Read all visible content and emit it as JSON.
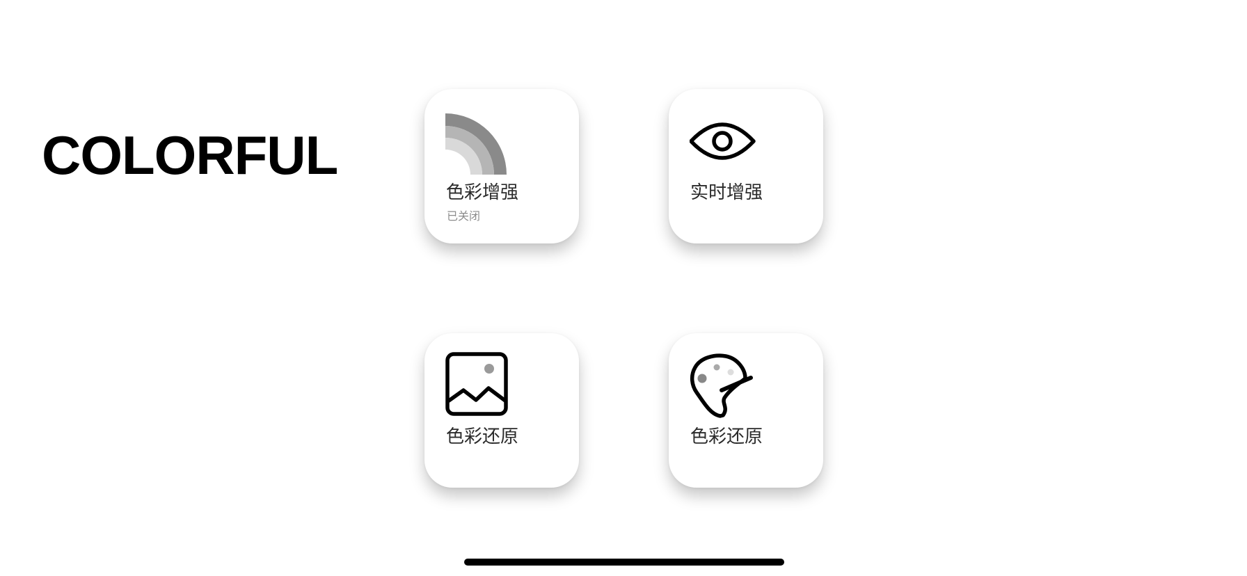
{
  "header": {
    "title": "COLORFUL"
  },
  "tiles": [
    {
      "label": "色彩增强",
      "status": "已关闭",
      "icon": "rainbow-icon"
    },
    {
      "label": "实时增强",
      "icon": "eye-icon"
    },
    {
      "label": "色彩还原",
      "icon": "image-icon"
    },
    {
      "label": "色彩还原",
      "icon": "palette-icon"
    }
  ],
  "colors": {
    "background": "#ffffff",
    "title_text": "#000000",
    "label_text": "#2b2b2b",
    "status_text": "#8c8c8c",
    "rainbow_outer": "#8a8a8a",
    "rainbow_middle": "#b5b5b5",
    "rainbow_inner": "#d9d9d9",
    "icon_stroke": "#000000",
    "home_indicator": "#000000"
  }
}
